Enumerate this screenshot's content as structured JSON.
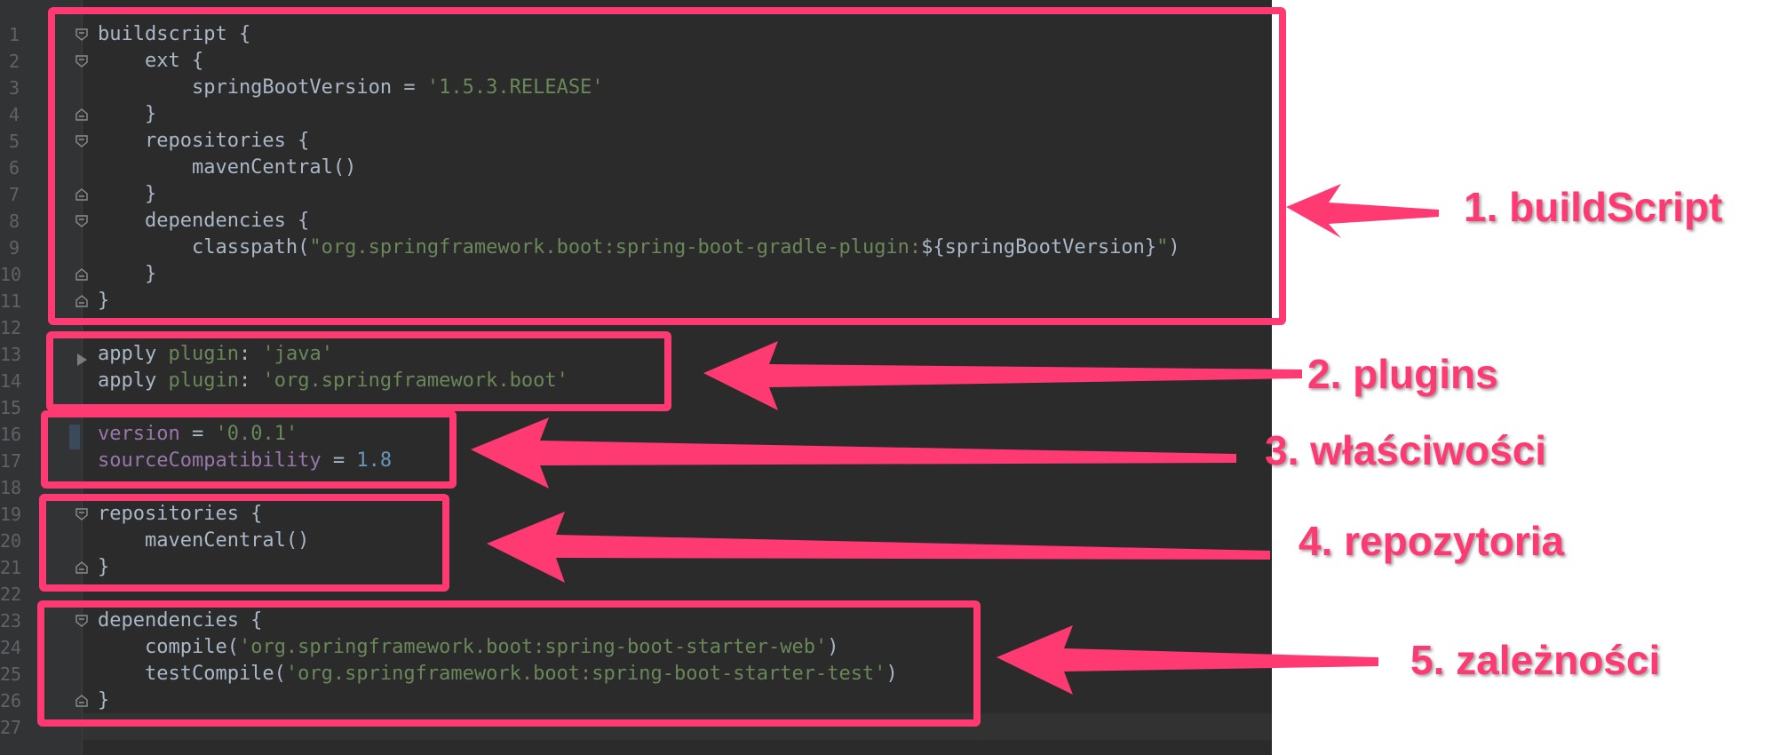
{
  "editor": {
    "line_numbers": [
      "1",
      "2",
      "3",
      "4",
      "5",
      "6",
      "7",
      "8",
      "9",
      "10",
      "11",
      "12",
      "13",
      "14",
      "15",
      "16",
      "17",
      "18",
      "19",
      "20",
      "21",
      "22",
      "23",
      "24",
      "25",
      "26",
      "27"
    ],
    "lines": [
      [
        {
          "t": "buildscript {",
          "c": "p"
        }
      ],
      [
        {
          "t": "    ext {",
          "c": "p"
        }
      ],
      [
        {
          "t": "        springBootVersion = ",
          "c": "p"
        },
        {
          "t": "'1.5.3.RELEASE'",
          "c": "s"
        }
      ],
      [
        {
          "t": "    }",
          "c": "p"
        }
      ],
      [
        {
          "t": "    repositories {",
          "c": "p"
        }
      ],
      [
        {
          "t": "        mavenCentral()",
          "c": "p"
        }
      ],
      [
        {
          "t": "    }",
          "c": "p"
        }
      ],
      [
        {
          "t": "    dependencies {",
          "c": "p"
        }
      ],
      [
        {
          "t": "        classpath(",
          "c": "p"
        },
        {
          "t": "\"org.springframework.boot:spring-boot-gradle-plugin:",
          "c": "g"
        },
        {
          "t": "${springBootVersion}",
          "c": "i"
        },
        {
          "t": "\"",
          "c": "g"
        },
        {
          "t": ")",
          "c": "p"
        }
      ],
      [
        {
          "t": "    }",
          "c": "p"
        }
      ],
      [
        {
          "t": "}",
          "c": "p"
        }
      ],
      [],
      [
        {
          "t": "apply ",
          "c": "p"
        },
        {
          "t": "plugin",
          "c": "g"
        },
        {
          "t": ": ",
          "c": "p"
        },
        {
          "t": "'java'",
          "c": "s"
        }
      ],
      [
        {
          "t": "apply ",
          "c": "p"
        },
        {
          "t": "plugin",
          "c": "g"
        },
        {
          "t": ": ",
          "c": "p"
        },
        {
          "t": "'org.springframework.boot'",
          "c": "s"
        }
      ],
      [],
      [
        {
          "t": "version",
          "c": "v"
        },
        {
          "t": " = ",
          "c": "p"
        },
        {
          "t": "'0.0.1'",
          "c": "s"
        }
      ],
      [
        {
          "t": "sourceCompatibility",
          "c": "v"
        },
        {
          "t": " = ",
          "c": "p"
        },
        {
          "t": "1.8",
          "c": "n"
        }
      ],
      [],
      [
        {
          "t": "repositories {",
          "c": "p"
        }
      ],
      [
        {
          "t": "    mavenCentral()",
          "c": "p"
        }
      ],
      [
        {
          "t": "}",
          "c": "p"
        }
      ],
      [],
      [
        {
          "t": "dependencies {",
          "c": "p"
        }
      ],
      [
        {
          "t": "    compile(",
          "c": "p"
        },
        {
          "t": "'org.springframework.boot:spring-boot-starter-web'",
          "c": "s"
        },
        {
          "t": ")",
          "c": "p"
        }
      ],
      [
        {
          "t": "    testCompile(",
          "c": "p"
        },
        {
          "t": "'org.springframework.boot:spring-boot-starter-test'",
          "c": "s"
        },
        {
          "t": ")",
          "c": "p"
        }
      ],
      [
        {
          "t": "}",
          "c": "p"
        }
      ],
      []
    ]
  },
  "annotations": [
    {
      "label": "1. buildScript"
    },
    {
      "label": "2. plugins"
    },
    {
      "label": "3. właściwości"
    },
    {
      "label": "4. repozytoria"
    },
    {
      "label": "5. zależności"
    }
  ],
  "colors": {
    "editor_bg": "#2b2b2b",
    "gutter_bg": "#313335",
    "line_number": "#606366",
    "plain": "#a9b7c6",
    "string": "#6a8759",
    "property": "#9876aa",
    "number": "#6897bb",
    "annotation_accent": "#ff3a73"
  },
  "icons": [
    "fold-open-icon",
    "fold-close-icon",
    "run-arrow-icon",
    "arrow-left-icon"
  ]
}
